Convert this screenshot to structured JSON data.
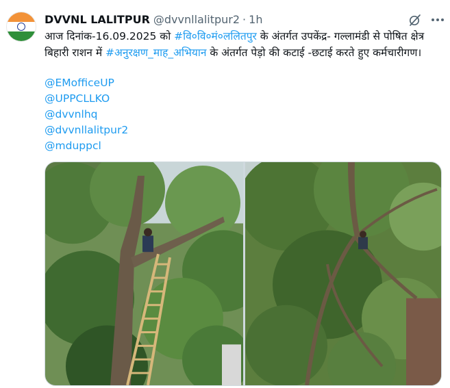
{
  "author": {
    "name": "DVVNL LALITPUR",
    "handle": "@dvvnllalitpur2",
    "separator": "·",
    "time": "1h",
    "avatar_icon": "india-flag-icon"
  },
  "tweet": {
    "text_part1": "आज दिनांक-16.09.2025 को ",
    "hashtag1": "#वि०वि०मं०ललितपुर",
    "text_part2": " के अंतर्गत उपकेंद्र- गल्लामंडी से पोषित क्षेत्र बिहारी राशन में ",
    "hashtag2": "#अनुरक्षण_माह_अभियान",
    "text_part3": " के अंतर्गत पेड़ो की कटाई -छटाई करते हुए कर्मचारीगण।",
    "mentions": [
      "@EMofficeUP",
      "@UPPCLLKO",
      "@dvvnlhq",
      "@dvvnllalitpur2",
      "@mduppcl"
    ]
  },
  "icons": {
    "grok": "grok-icon",
    "more": "more-options-icon"
  },
  "colors": {
    "link": "#1d9bf0",
    "secondary_text": "#536471",
    "primary_text": "#0f1419"
  },
  "media": {
    "count": 2,
    "image1_desc_name": "tree-trimming-photo-ladder",
    "image2_desc_name": "tree-trimming-photo-branches"
  }
}
